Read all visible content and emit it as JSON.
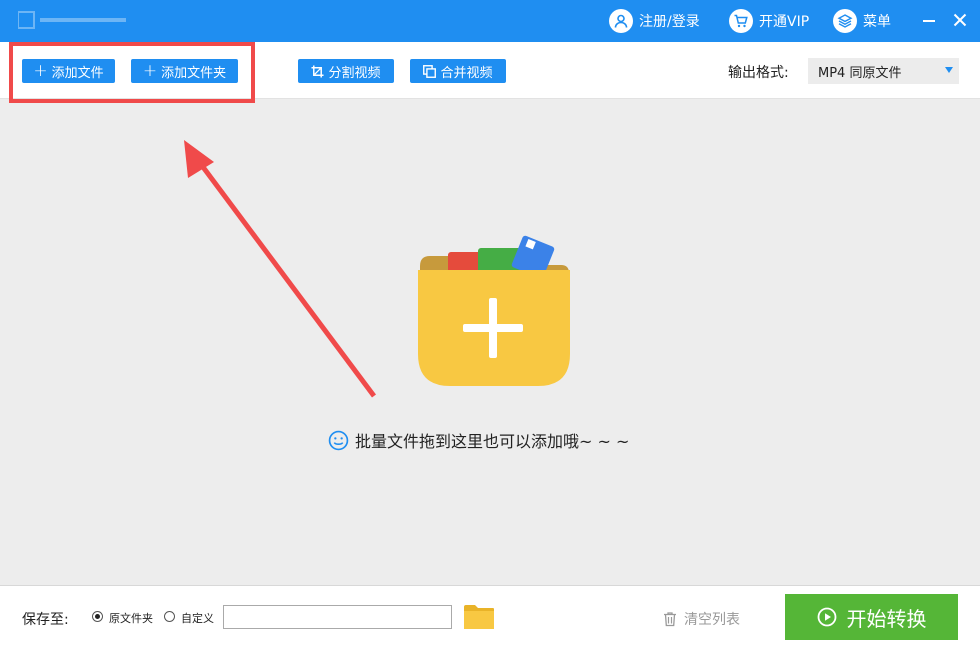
{
  "titlebar": {
    "register_label": "注册/登录",
    "vip_label": "开通VIP",
    "menu_label": "菜单"
  },
  "toolbar": {
    "add_file_label": "添加文件",
    "add_folder_label": "添加文件夹",
    "split_label": "分割视频",
    "merge_label": "合并视频",
    "output_format_label": "输出格式:",
    "output_format_value": "MP4  同原文件"
  },
  "dropzone": {
    "hint": "批量文件拖到这里也可以添加哦~ ~ ~"
  },
  "footer": {
    "save_to_label": "保存至:",
    "radio_original": "原文件夹",
    "radio_custom": "自定义",
    "path_value": "",
    "clear_list_label": "清空列表",
    "start_label": "开始转换"
  },
  "colors": {
    "accent": "#1f8ef1",
    "annotation": "#f04a4a",
    "start": "#55b637",
    "folder": "#f8c842"
  }
}
